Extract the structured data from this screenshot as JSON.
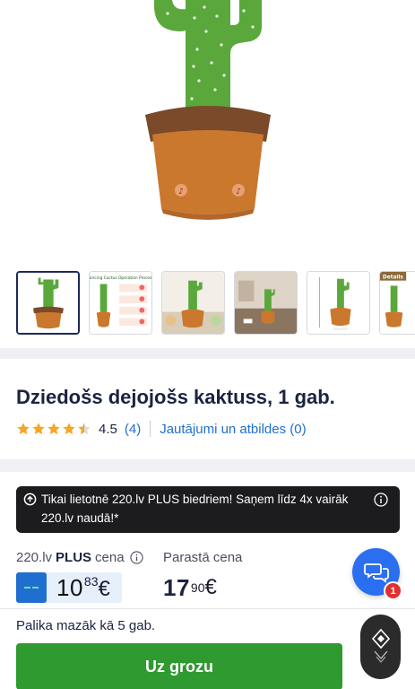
{
  "product": {
    "title": "Dziedošs dejojošs kaktuss, 1 gab.",
    "rating_value": "4.5",
    "rating_count": "(4)",
    "rating_stars": 4.5,
    "qa_link": "Jautājumi un atbildes (0)"
  },
  "gallery": {
    "thumbnails": [
      {
        "name": "cactus-photo",
        "active": true
      },
      {
        "name": "operation-process-diagram",
        "caption": "Dancing Cactus Operation Process",
        "active": false
      },
      {
        "name": "cactus-lifestyle-photo",
        "active": false
      },
      {
        "name": "cactus-room-photo",
        "active": false
      },
      {
        "name": "cactus-size-photo",
        "active": false
      },
      {
        "name": "cactus-details-photo",
        "caption": "Details",
        "active": false
      }
    ]
  },
  "promo": {
    "text": "Tikai lietotnē 220.lv PLUS biedriem! Saņem līdz 4x vairāk 220.lv naudā!*"
  },
  "pricing": {
    "plus_label_prefix": "220.lv ",
    "plus_label_bold": "PLUS",
    "plus_label_suffix": " cena",
    "plus_price_whole": "10",
    "plus_price_cents": "83",
    "currency": "€",
    "regular_label": "Parastā cena",
    "regular_price_whole": "17",
    "regular_price_cents": "90"
  },
  "chat": {
    "badge_count": "1"
  },
  "bottom_bar": {
    "stock_text": "Palika mazāk kā 5 gab.",
    "cart_button": "Uz grozu"
  },
  "colors": {
    "accent_blue": "#1f6fd0",
    "cart_green": "#2f9a2f",
    "promo_bg": "#1c1c1f",
    "star": "#f5a623"
  }
}
